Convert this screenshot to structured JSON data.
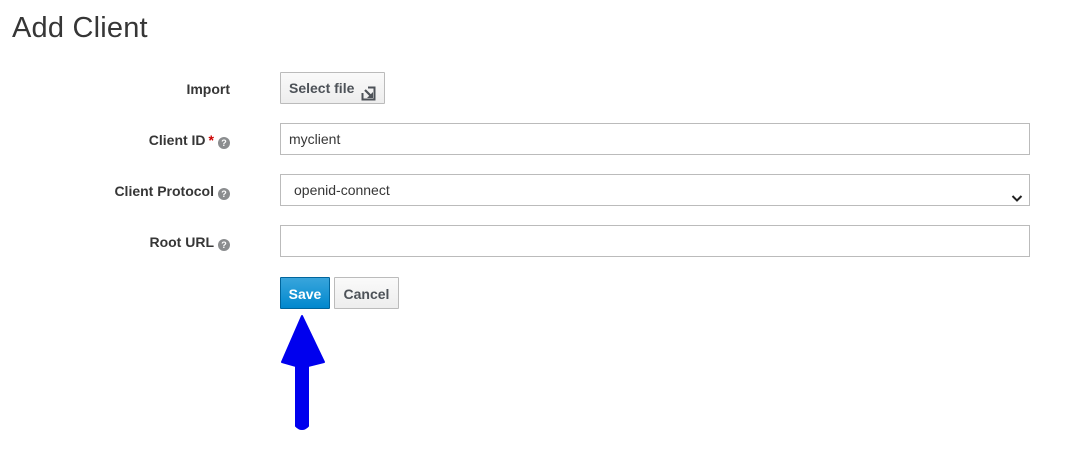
{
  "page": {
    "title": "Add Client"
  },
  "form": {
    "import": {
      "label": "Import",
      "button_label": "Select file"
    },
    "client_id": {
      "label": "Client ID",
      "required_mark": "*",
      "value": "myclient"
    },
    "client_protocol": {
      "label": "Client Protocol",
      "selected": "openid-connect"
    },
    "root_url": {
      "label": "Root URL",
      "value": ""
    },
    "help_glyph": "?",
    "actions": {
      "save_label": "Save",
      "cancel_label": "Cancel"
    }
  },
  "colors": {
    "primary": "#0088ce",
    "annotation_arrow": "#0000ee",
    "required": "#cc0000"
  },
  "icons": {
    "select_file": "external-link-icon",
    "help": "help-circle-icon",
    "select": "chevron-down-icon",
    "annotation": "up-arrow-annotation"
  }
}
